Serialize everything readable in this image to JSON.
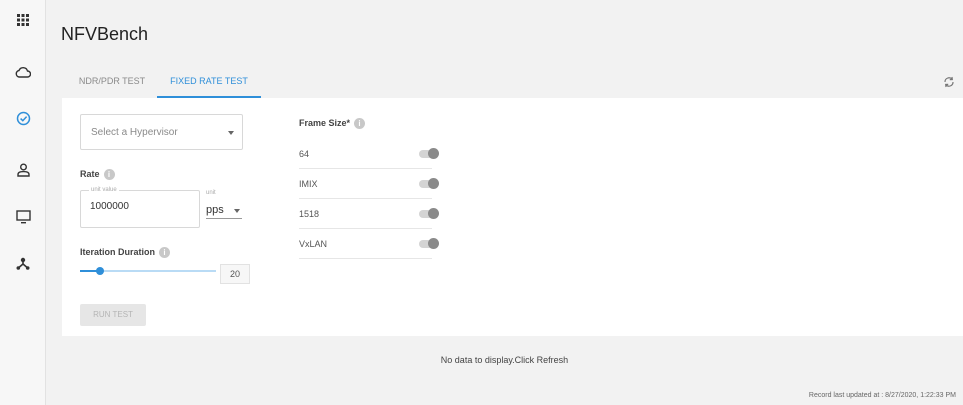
{
  "sidebar": {
    "items": [
      {
        "icon": "apps-grid-icon"
      },
      {
        "icon": "cloud-icon"
      },
      {
        "icon": "check-circle-icon",
        "active": true
      },
      {
        "icon": "user-icon"
      },
      {
        "icon": "monitor-icon"
      },
      {
        "icon": "network-icon"
      }
    ],
    "active_color": "#2f8fd9"
  },
  "page": {
    "title": "NFVBench"
  },
  "tabs": [
    {
      "label": "NDR/PDR TEST",
      "active": false
    },
    {
      "label": "FIXED RATE TEST",
      "active": true
    }
  ],
  "form": {
    "hypervisor": {
      "placeholder": "Select a Hypervisor"
    },
    "rate": {
      "label": "Rate",
      "legend": "unit value",
      "value": "1000000",
      "unit_label": "unit",
      "unit_value": "pps"
    },
    "iteration": {
      "label": "Iteration Duration",
      "value": "20",
      "fraction": 0.15
    },
    "run_button": "RUN TEST"
  },
  "frame_size": {
    "label": "Frame Size*",
    "options": [
      {
        "name": "64",
        "on": false
      },
      {
        "name": "IMIX",
        "on": false
      },
      {
        "name": "1518",
        "on": false
      },
      {
        "name": "VxLAN",
        "on": false
      }
    ]
  },
  "results": {
    "empty_message": "No data to display.Click Refresh"
  },
  "footer": {
    "last_updated": "Record last updated at : 8/27/2020, 1:22:33 PM"
  },
  "colors": {
    "accent": "#2f8fd9",
    "icon": "#333333"
  }
}
